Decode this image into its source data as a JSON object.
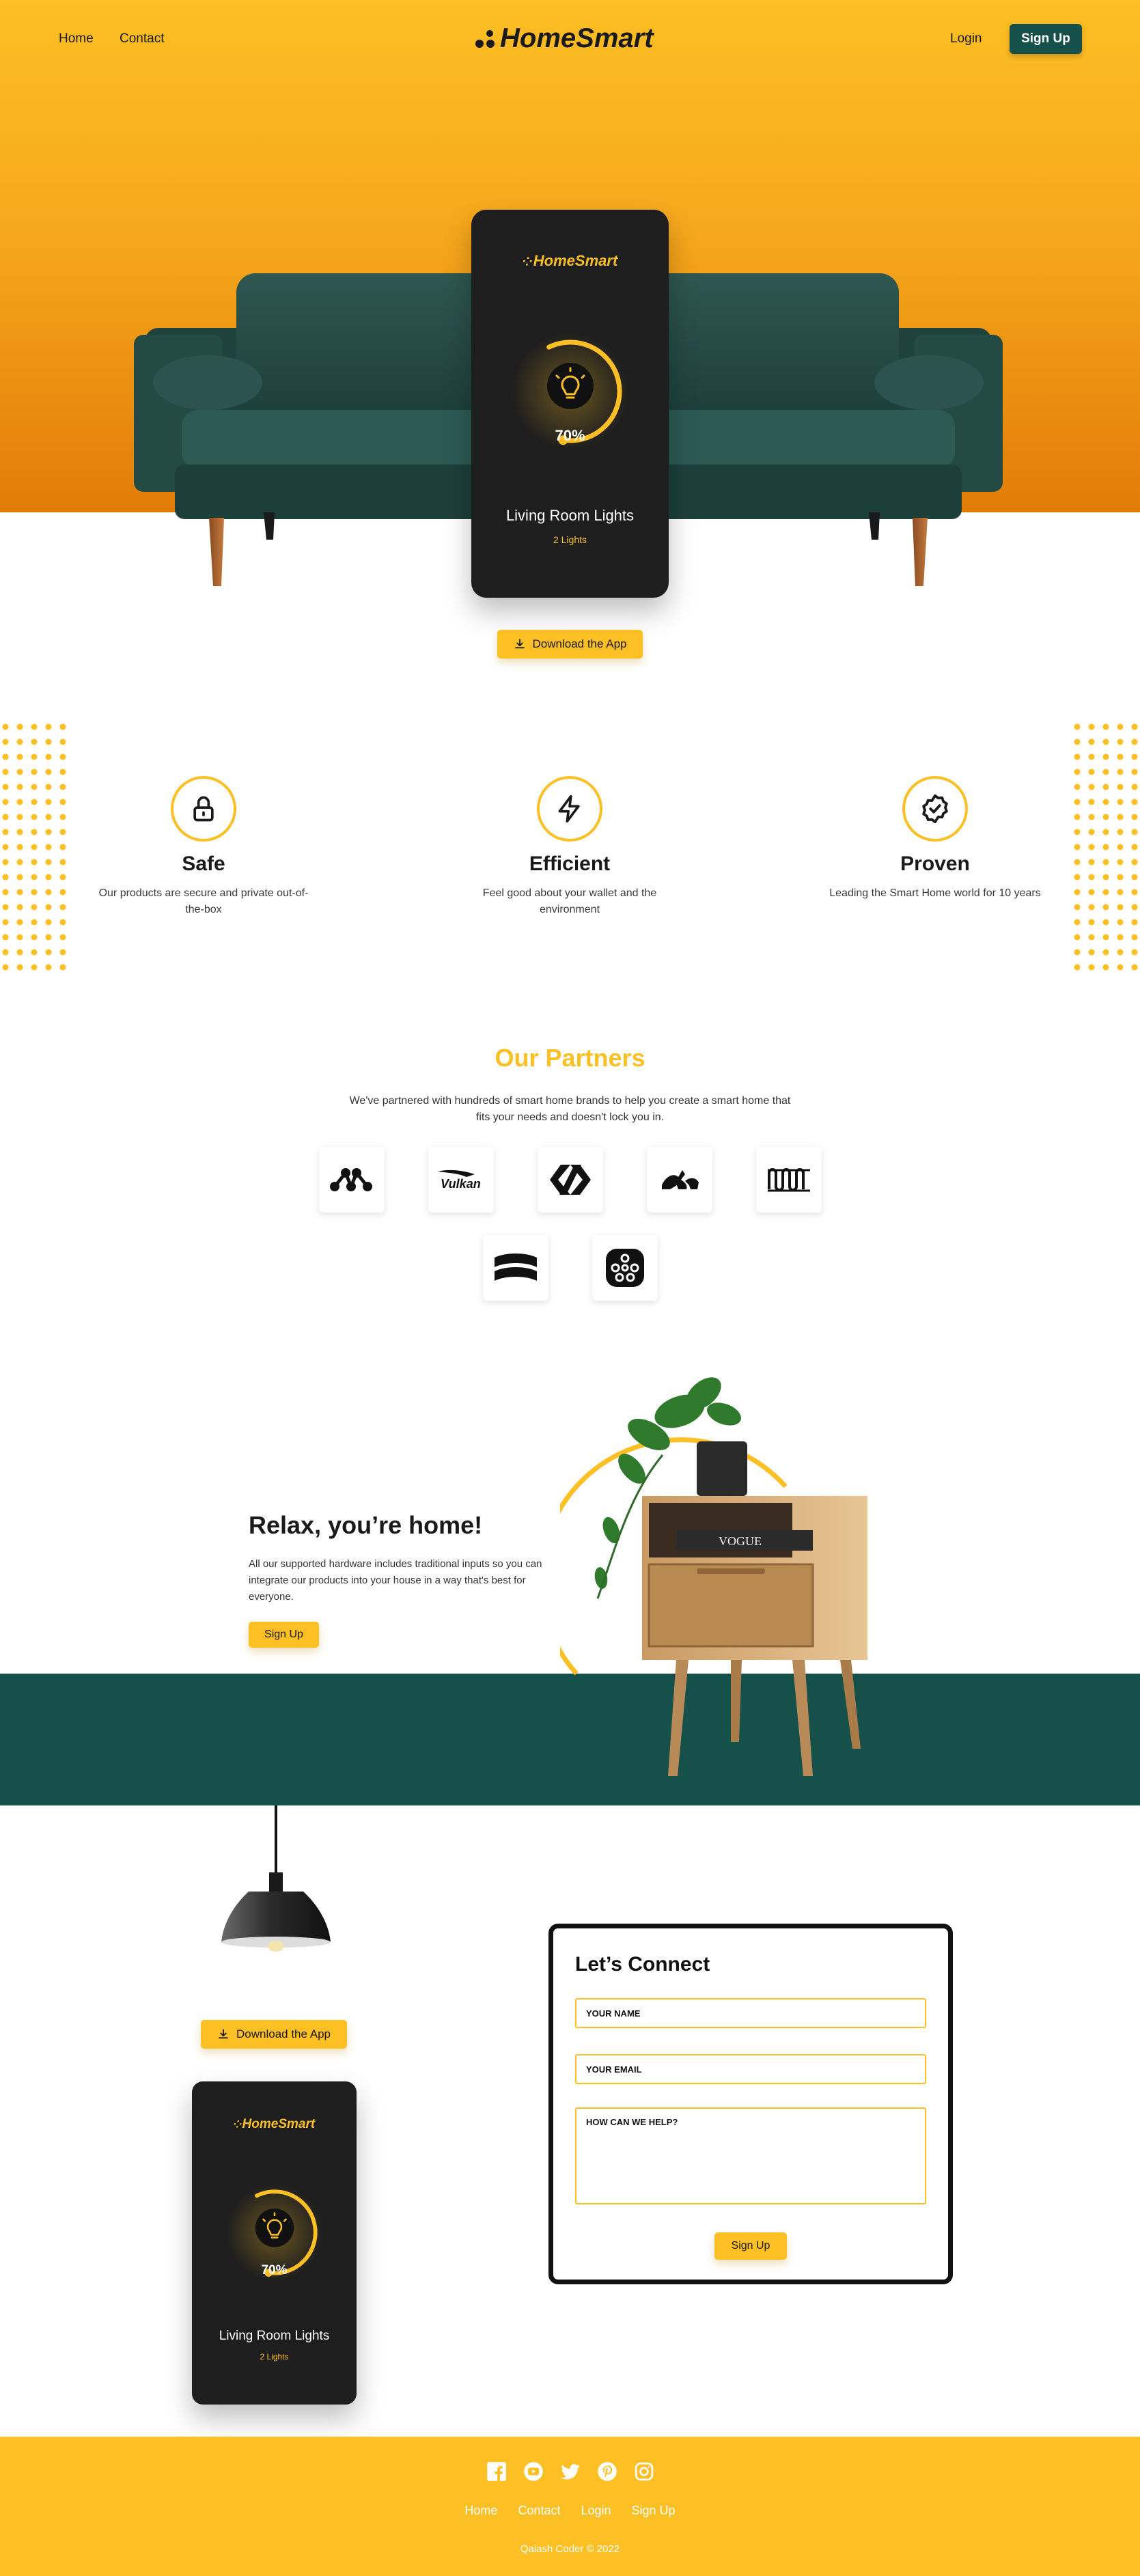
{
  "nav": {
    "links": [
      {
        "label": "Home"
      },
      {
        "label": "Contact"
      }
    ],
    "brand": "HomeSmart",
    "login": "Login",
    "signup": "Sign Up"
  },
  "hero": {
    "card": {
      "brand": "HomeSmart",
      "level_percent": 70,
      "level_label": "70%",
      "title": "Living Room Lights",
      "subtitle": "2 Lights"
    },
    "download_label": "Download the App"
  },
  "features": [
    {
      "title": "Safe",
      "text": "Our products are secure and private out-of-the-box",
      "icon": "lock-icon"
    },
    {
      "title": "Efficient",
      "text": "Feel good about your wallet and the environment",
      "icon": "lightning-icon"
    },
    {
      "title": "Proven",
      "text": "Leading the Smart Home world for 10 years",
      "icon": "badge-check-icon"
    }
  ],
  "partners": {
    "title": "Our Partners",
    "text": "We've partnered with hundreds of smart home brands to help you create a smart home that fits your needs and doesn't lock you in.",
    "logos": [
      "matrix-logo",
      "vulkan-logo",
      "codepen-logo",
      "dogs-logo",
      "wave-logo",
      "stack-logo",
      "hub-logo"
    ],
    "vulkan_text": "Vulkan",
    "vogue_text": "VOGUE"
  },
  "relax": {
    "title": "Relax, you’re home!",
    "text": "All our supported hardware includes traditional inputs so you can integrate our products into your house in a way that's best for everyone.",
    "cta": "Sign Up"
  },
  "connect": {
    "download_label": "Download the App",
    "card": {
      "brand": "HomeSmart",
      "level_percent": 70,
      "level_label": "70%",
      "title": "Living Room Lights",
      "subtitle": "2 Lights"
    },
    "form": {
      "title": "Let’s Connect",
      "name_placeholder": "YOUR NAME",
      "email_placeholder": "YOUR EMAIL",
      "message_placeholder": "HOW CAN WE HELP?",
      "submit": "Sign Up"
    }
  },
  "footer": {
    "social": [
      "facebook-icon",
      "youtube-icon",
      "twitter-icon",
      "pinterest-icon",
      "instagram-icon"
    ],
    "links": [
      {
        "label": "Home"
      },
      {
        "label": "Contact"
      },
      {
        "label": "Login"
      },
      {
        "label": "Sign Up"
      }
    ],
    "copyright": "Qaiash Coder © 2022"
  },
  "colors": {
    "brand_yellow": "#fcbf24",
    "brand_orange": "#e27c08",
    "brand_teal": "#15504a",
    "card_dark": "#1e1e1e"
  }
}
